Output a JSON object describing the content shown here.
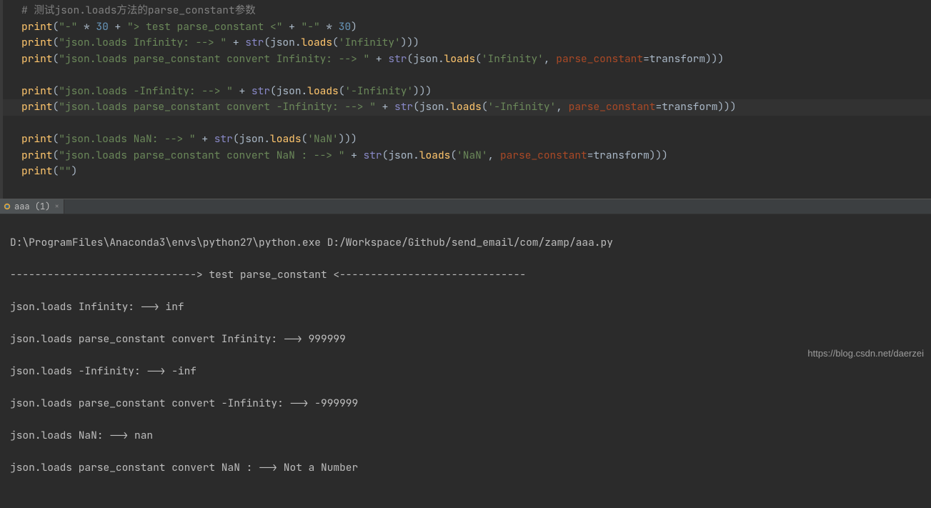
{
  "code": {
    "comment": "# 测试json.loads方法的parse_constant参数",
    "lines": [
      {
        "s": "\"-\"",
        "n": "30",
        "mid": "\"> test parse_constant <\""
      },
      {
        "s": "\"json.loads Infinity: --> \"",
        "arg": "'Infinity'"
      },
      {
        "s": "\"json.loads parse_constant convert Infinity: --> \"",
        "arg": "'Infinity'",
        "kw": "parse_constant",
        "kv": "transform"
      },
      {
        "s": "\"json.loads -Infinity: --> \"",
        "arg": "'-Infinity'"
      },
      {
        "s": "\"json.loads parse_constant convert -Infinity: --> \"",
        "arg": "'-Infinity'",
        "kw": "parse_constant",
        "kv": "transform"
      },
      {
        "s": "\"json.loads NaN: --> \"",
        "arg": "'NaN'"
      },
      {
        "s": "\"json.loads parse_constant convert NaN : --> \"",
        "arg": "'NaN'",
        "kw": "parse_constant",
        "kv": "transform"
      },
      {
        "s": "\"\""
      }
    ],
    "fn_print": "print",
    "fn_str": "str",
    "fn_json": "json",
    "fn_loads": "loads",
    "star": "*",
    "plus": "+",
    "comma": ","
  },
  "tab": {
    "label": "aaa (1)"
  },
  "console": {
    "lines": [
      "D:\\ProgramFiles\\Anaconda3\\envs\\python27\\python.exe D:/Workspace/Github/send_email/com/zamp/aaa.py",
      "------------------------------> test parse_constant <------------------------------",
      "json.loads Infinity: --> inf",
      "json.loads parse_constant convert Infinity: --> 999999",
      "json.loads -Infinity: --> -inf",
      "json.loads parse_constant convert -Infinity: --> -999999",
      "json.loads NaN: --> nan",
      "json.loads parse_constant convert NaN : --> Not a Number"
    ]
  },
  "watermark": "https://blog.csdn.net/daerzei"
}
